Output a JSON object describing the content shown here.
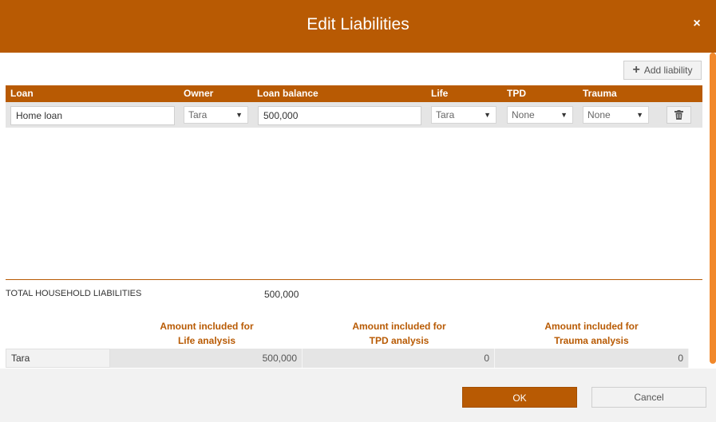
{
  "dialog": {
    "title": "Edit Liabilities",
    "close_glyph": "×"
  },
  "toolbar": {
    "add_label": "Add liability"
  },
  "table": {
    "headers": {
      "loan": "Loan",
      "owner": "Owner",
      "balance": "Loan balance",
      "life": "Life",
      "tpd": "TPD",
      "trauma": "Trauma"
    },
    "rows": [
      {
        "loan": "Home loan",
        "owner": "Tara",
        "balance": "500,000",
        "life": "Tara",
        "tpd": "None",
        "trauma": "None"
      }
    ]
  },
  "totals": {
    "label": "TOTAL HOUSEHOLD LIABILITIES",
    "value": "500,000"
  },
  "analysis": {
    "headers": {
      "life_line1": "Amount included for",
      "life_line2": "Life analysis",
      "tpd_line1": "Amount included for",
      "tpd_line2": "TPD analysis",
      "trauma_line1": "Amount included for",
      "trauma_line2": "Trauma analysis"
    },
    "rows": [
      {
        "name": "Tara",
        "life": "500,000",
        "tpd": "0",
        "trauma": "0"
      }
    ]
  },
  "footer": {
    "ok_label": "OK",
    "cancel_label": "Cancel"
  },
  "colors": {
    "brand": "#b85a03",
    "scrollbar": "#f1882b"
  }
}
